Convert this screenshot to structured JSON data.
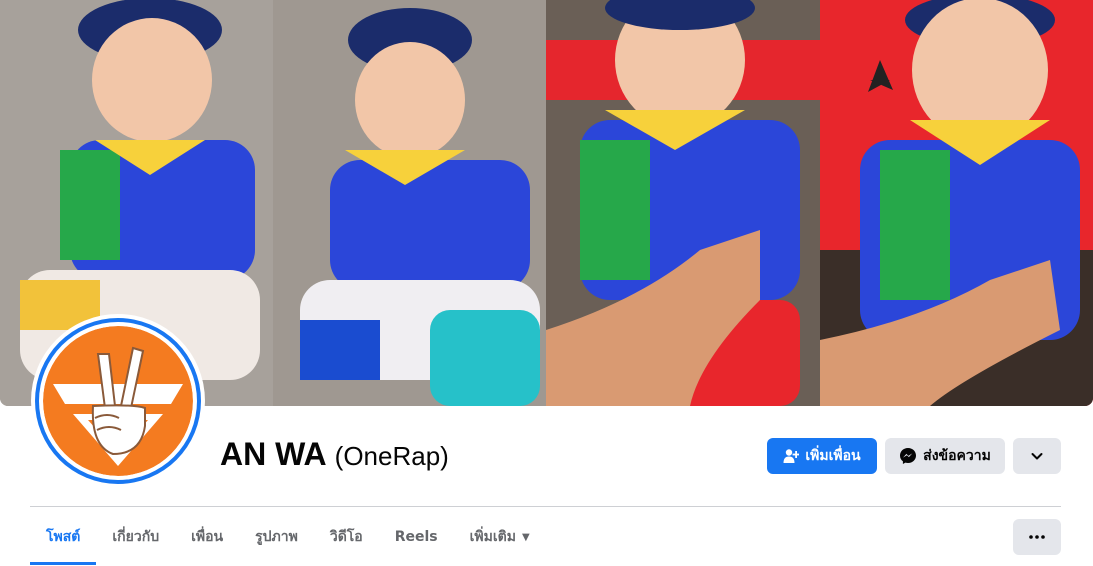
{
  "profile": {
    "name": "AN WA",
    "alternate_name": "(OneRap)"
  },
  "actions": {
    "add_friend_label": "เพิ่มเพื่อน",
    "message_label": "ส่งข้อความ"
  },
  "tabs": [
    {
      "label": "โพสต์",
      "active": true
    },
    {
      "label": "เกี่ยวกับ",
      "active": false
    },
    {
      "label": "เพื่อน",
      "active": false
    },
    {
      "label": "รูปภาพ",
      "active": false
    },
    {
      "label": "วิดีโอ",
      "active": false
    },
    {
      "label": "Reels",
      "active": false
    },
    {
      "label": "เพิ่มเติม",
      "active": false
    }
  ],
  "icons": {
    "add_friend": "person-plus-icon",
    "messenger": "messenger-icon",
    "dropdown": "chevron-down-icon",
    "more": "ellipsis-icon",
    "more_tab_caret": "caret-down-icon"
  },
  "colors": {
    "accent": "#1877f2",
    "button_secondary": "#e4e6eb",
    "text_primary": "#050505",
    "text_secondary": "#65676b",
    "avatar_orange": "#f47b20"
  }
}
